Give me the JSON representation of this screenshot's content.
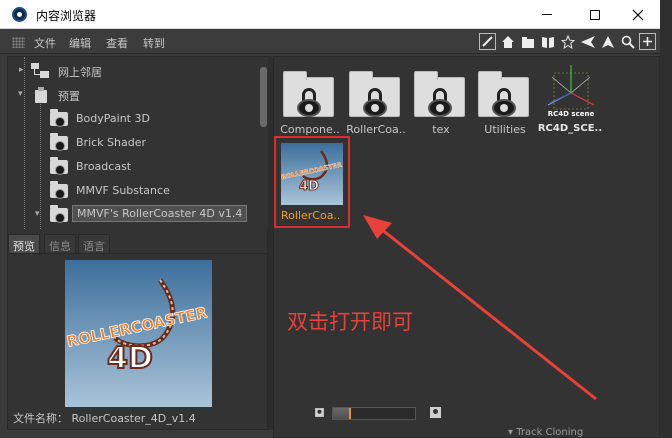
{
  "window": {
    "title": "内容浏览器"
  },
  "menu": {
    "items": [
      "文件",
      "编辑",
      "查看",
      "转到"
    ]
  },
  "toolbar": {
    "icons": [
      "edit-icon",
      "home-icon",
      "folder-up-icon",
      "book-icon",
      "star-icon",
      "back-icon",
      "forward-icon",
      "search-icon",
      "add-icon"
    ]
  },
  "tree": {
    "items": [
      {
        "label": "网上邻居",
        "icon": "network-icon",
        "level": 1
      },
      {
        "label": "预置",
        "icon": "preset-icon",
        "level": 1
      },
      {
        "label": "BodyPaint 3D",
        "icon": "locked-folder-icon",
        "level": 2
      },
      {
        "label": "Brick Shader",
        "icon": "locked-folder-icon",
        "level": 2
      },
      {
        "label": "Broadcast",
        "icon": "locked-folder-icon",
        "level": 2
      },
      {
        "label": "MMVF Substance",
        "icon": "locked-folder-icon",
        "level": 2
      },
      {
        "label": "MMVF's RollerCoaster 4D v1.4",
        "icon": "locked-folder-icon",
        "level": 2,
        "selected": true
      }
    ]
  },
  "tabs": [
    {
      "label": "预览",
      "active": true
    },
    {
      "label": "信息",
      "active": false
    },
    {
      "label": "语言",
      "active": false
    }
  ],
  "preview": {
    "file_name_label": "文件名称：",
    "file_name": "RollerCoaster_4D_v1.4",
    "logo_text": "ROLLERCOASTER",
    "logo_sub": "4D"
  },
  "browser": {
    "items": [
      {
        "label": "Compone..",
        "type": "locked-folder"
      },
      {
        "label": "RollerCoa..",
        "type": "locked-folder"
      },
      {
        "label": "tex",
        "type": "locked-folder"
      },
      {
        "label": "Utilities",
        "type": "locked-folder"
      },
      {
        "label": "RC4D_SCE..",
        "type": "scene",
        "badge": "RC4D scene"
      }
    ],
    "selected": {
      "label": "RollerCoa.."
    }
  },
  "annotation": {
    "text": "双击打开即可",
    "color": "#e8403a"
  },
  "zoom": {
    "level": 0.2
  },
  "background": {
    "bottom_text": "▾ Track Cloning"
  },
  "colors": {
    "highlight": "#d9302c",
    "selected_label": "#f0a030"
  }
}
